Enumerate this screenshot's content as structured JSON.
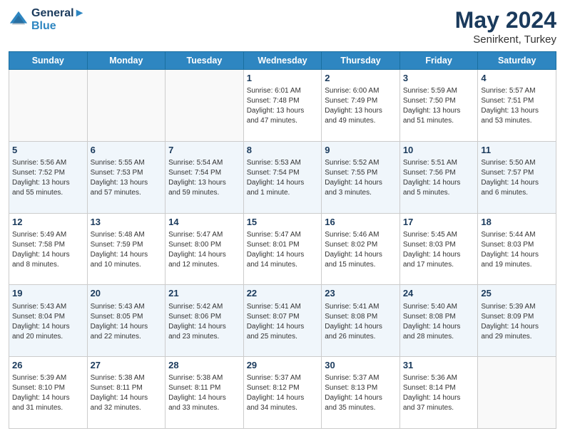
{
  "logo": {
    "line1": "General",
    "line2": "Blue"
  },
  "header": {
    "title": "May 2024",
    "subtitle": "Senirkent, Turkey"
  },
  "weekdays": [
    "Sunday",
    "Monday",
    "Tuesday",
    "Wednesday",
    "Thursday",
    "Friday",
    "Saturday"
  ],
  "weeks": [
    [
      {
        "day": "",
        "info": []
      },
      {
        "day": "",
        "info": []
      },
      {
        "day": "",
        "info": []
      },
      {
        "day": "1",
        "info": [
          "Sunrise: 6:01 AM",
          "Sunset: 7:48 PM",
          "Daylight: 13 hours",
          "and 47 minutes."
        ]
      },
      {
        "day": "2",
        "info": [
          "Sunrise: 6:00 AM",
          "Sunset: 7:49 PM",
          "Daylight: 13 hours",
          "and 49 minutes."
        ]
      },
      {
        "day": "3",
        "info": [
          "Sunrise: 5:59 AM",
          "Sunset: 7:50 PM",
          "Daylight: 13 hours",
          "and 51 minutes."
        ]
      },
      {
        "day": "4",
        "info": [
          "Sunrise: 5:57 AM",
          "Sunset: 7:51 PM",
          "Daylight: 13 hours",
          "and 53 minutes."
        ]
      }
    ],
    [
      {
        "day": "5",
        "info": [
          "Sunrise: 5:56 AM",
          "Sunset: 7:52 PM",
          "Daylight: 13 hours",
          "and 55 minutes."
        ]
      },
      {
        "day": "6",
        "info": [
          "Sunrise: 5:55 AM",
          "Sunset: 7:53 PM",
          "Daylight: 13 hours",
          "and 57 minutes."
        ]
      },
      {
        "day": "7",
        "info": [
          "Sunrise: 5:54 AM",
          "Sunset: 7:54 PM",
          "Daylight: 13 hours",
          "and 59 minutes."
        ]
      },
      {
        "day": "8",
        "info": [
          "Sunrise: 5:53 AM",
          "Sunset: 7:54 PM",
          "Daylight: 14 hours",
          "and 1 minute."
        ]
      },
      {
        "day": "9",
        "info": [
          "Sunrise: 5:52 AM",
          "Sunset: 7:55 PM",
          "Daylight: 14 hours",
          "and 3 minutes."
        ]
      },
      {
        "day": "10",
        "info": [
          "Sunrise: 5:51 AM",
          "Sunset: 7:56 PM",
          "Daylight: 14 hours",
          "and 5 minutes."
        ]
      },
      {
        "day": "11",
        "info": [
          "Sunrise: 5:50 AM",
          "Sunset: 7:57 PM",
          "Daylight: 14 hours",
          "and 6 minutes."
        ]
      }
    ],
    [
      {
        "day": "12",
        "info": [
          "Sunrise: 5:49 AM",
          "Sunset: 7:58 PM",
          "Daylight: 14 hours",
          "and 8 minutes."
        ]
      },
      {
        "day": "13",
        "info": [
          "Sunrise: 5:48 AM",
          "Sunset: 7:59 PM",
          "Daylight: 14 hours",
          "and 10 minutes."
        ]
      },
      {
        "day": "14",
        "info": [
          "Sunrise: 5:47 AM",
          "Sunset: 8:00 PM",
          "Daylight: 14 hours",
          "and 12 minutes."
        ]
      },
      {
        "day": "15",
        "info": [
          "Sunrise: 5:47 AM",
          "Sunset: 8:01 PM",
          "Daylight: 14 hours",
          "and 14 minutes."
        ]
      },
      {
        "day": "16",
        "info": [
          "Sunrise: 5:46 AM",
          "Sunset: 8:02 PM",
          "Daylight: 14 hours",
          "and 15 minutes."
        ]
      },
      {
        "day": "17",
        "info": [
          "Sunrise: 5:45 AM",
          "Sunset: 8:03 PM",
          "Daylight: 14 hours",
          "and 17 minutes."
        ]
      },
      {
        "day": "18",
        "info": [
          "Sunrise: 5:44 AM",
          "Sunset: 8:03 PM",
          "Daylight: 14 hours",
          "and 19 minutes."
        ]
      }
    ],
    [
      {
        "day": "19",
        "info": [
          "Sunrise: 5:43 AM",
          "Sunset: 8:04 PM",
          "Daylight: 14 hours",
          "and 20 minutes."
        ]
      },
      {
        "day": "20",
        "info": [
          "Sunrise: 5:43 AM",
          "Sunset: 8:05 PM",
          "Daylight: 14 hours",
          "and 22 minutes."
        ]
      },
      {
        "day": "21",
        "info": [
          "Sunrise: 5:42 AM",
          "Sunset: 8:06 PM",
          "Daylight: 14 hours",
          "and 23 minutes."
        ]
      },
      {
        "day": "22",
        "info": [
          "Sunrise: 5:41 AM",
          "Sunset: 8:07 PM",
          "Daylight: 14 hours",
          "and 25 minutes."
        ]
      },
      {
        "day": "23",
        "info": [
          "Sunrise: 5:41 AM",
          "Sunset: 8:08 PM",
          "Daylight: 14 hours",
          "and 26 minutes."
        ]
      },
      {
        "day": "24",
        "info": [
          "Sunrise: 5:40 AM",
          "Sunset: 8:08 PM",
          "Daylight: 14 hours",
          "and 28 minutes."
        ]
      },
      {
        "day": "25",
        "info": [
          "Sunrise: 5:39 AM",
          "Sunset: 8:09 PM",
          "Daylight: 14 hours",
          "and 29 minutes."
        ]
      }
    ],
    [
      {
        "day": "26",
        "info": [
          "Sunrise: 5:39 AM",
          "Sunset: 8:10 PM",
          "Daylight: 14 hours",
          "and 31 minutes."
        ]
      },
      {
        "day": "27",
        "info": [
          "Sunrise: 5:38 AM",
          "Sunset: 8:11 PM",
          "Daylight: 14 hours",
          "and 32 minutes."
        ]
      },
      {
        "day": "28",
        "info": [
          "Sunrise: 5:38 AM",
          "Sunset: 8:11 PM",
          "Daylight: 14 hours",
          "and 33 minutes."
        ]
      },
      {
        "day": "29",
        "info": [
          "Sunrise: 5:37 AM",
          "Sunset: 8:12 PM",
          "Daylight: 14 hours",
          "and 34 minutes."
        ]
      },
      {
        "day": "30",
        "info": [
          "Sunrise: 5:37 AM",
          "Sunset: 8:13 PM",
          "Daylight: 14 hours",
          "and 35 minutes."
        ]
      },
      {
        "day": "31",
        "info": [
          "Sunrise: 5:36 AM",
          "Sunset: 8:14 PM",
          "Daylight: 14 hours",
          "and 37 minutes."
        ]
      },
      {
        "day": "",
        "info": []
      }
    ]
  ]
}
